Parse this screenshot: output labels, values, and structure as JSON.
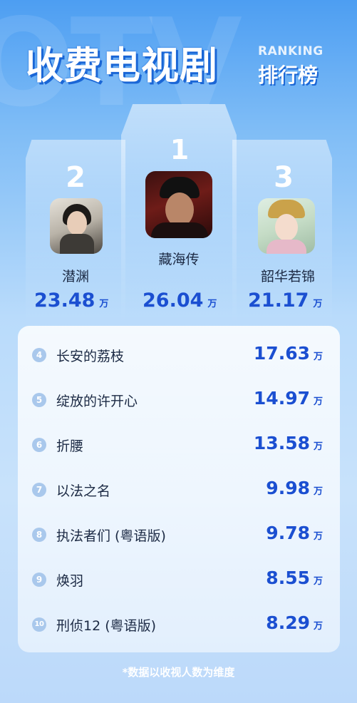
{
  "header": {
    "title": "收费电视剧",
    "subtitle_en": "RANKING",
    "subtitle_cn": "排行榜"
  },
  "top3": [
    {
      "rank": "1",
      "name": "藏海传",
      "value": "26.04",
      "unit": "万"
    },
    {
      "rank": "2",
      "name": "潜渊",
      "value": "23.48",
      "unit": "万"
    },
    {
      "rank": "3",
      "name": "韶华若锦",
      "value": "21.17",
      "unit": "万"
    }
  ],
  "list": [
    {
      "rank": "4",
      "name": "长安的荔枝",
      "value": "17.63",
      "unit": "万"
    },
    {
      "rank": "5",
      "name": "绽放的许开心",
      "value": "14.97",
      "unit": "万"
    },
    {
      "rank": "6",
      "name": "折腰",
      "value": "13.58",
      "unit": "万"
    },
    {
      "rank": "7",
      "name": "以法之名",
      "value": "9.98",
      "unit": "万"
    },
    {
      "rank": "8",
      "name": "执法者们 (粤语版)",
      "value": "9.78",
      "unit": "万"
    },
    {
      "rank": "9",
      "name": "焕羽",
      "value": "8.55",
      "unit": "万"
    },
    {
      "rank": "10",
      "name": "刑侦12 (粤语版)",
      "value": "8.29",
      "unit": "万"
    }
  ],
  "footnote": "*数据以收视人数为维度",
  "colors": {
    "accent": "#1b4fd1",
    "background_top": "#4d9ef2",
    "background_bottom": "#bcd9fa",
    "badge": "#a9c8ec"
  }
}
